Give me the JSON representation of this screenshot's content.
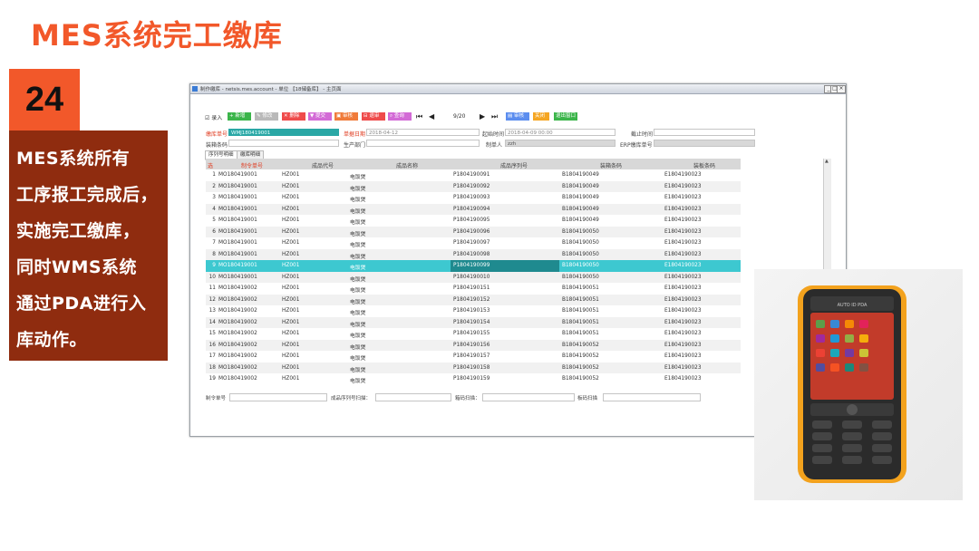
{
  "slide": {
    "title": "MES系统完工缴库",
    "number": "24",
    "description_lines": [
      "MES系统所有",
      "工序报工完成后，",
      "实施完工缴库，",
      "同时WMS系统",
      "通过PDA进行入",
      "库动作。"
    ]
  },
  "window": {
    "title": "制作缴库 - netsis.mes.account - 单位 【18储备库】 - 主页面",
    "controls": [
      "_",
      "□",
      "×"
    ]
  },
  "toolbar": {
    "checkbox_label": "录入",
    "buttons": [
      {
        "label": "新增",
        "color": "#3bb54a"
      },
      {
        "label": "修改",
        "color": "#b9b9b9"
      },
      {
        "label": "删除",
        "color": "#ef4b4b"
      },
      {
        "label": "提交",
        "color": "#d36ad6"
      },
      {
        "label": "审核",
        "color": "#f07b3a"
      },
      {
        "label": "退审",
        "color": "#ef4b4b"
      },
      {
        "label": "查询",
        "color": "#d36ad6"
      }
    ],
    "page": "9/20",
    "extra_buttons": [
      {
        "label": "审核",
        "color": "#5b8def"
      },
      {
        "label": "关闭",
        "color": "#f5a623"
      },
      {
        "label": "退出窗口",
        "color": "#3bb54a"
      }
    ]
  },
  "form": {
    "doc_no_label": "缴库单号",
    "doc_no_value": "WMJ180419001",
    "doc_date_label": "单据日期",
    "doc_date_value": "2018-04-12",
    "start_time_label": "起始时间",
    "start_time_value": "2018-04-09 00:00",
    "end_time_label": "截止时间",
    "end_time_value": "",
    "box_label": "装箱条码",
    "box_value": "",
    "dept_label": "生产部门",
    "dept_value": "",
    "creator_label": "制单人",
    "creator_value": "zzh",
    "erp_label": "ERP缴库单号",
    "erp_value": ""
  },
  "tabs": [
    "序列号明细",
    "缴库明细"
  ],
  "grid": {
    "headers": [
      "选",
      "制令单号",
      "成品代号",
      "成品名称",
      "成品序列号",
      "装箱条码",
      "装板条码"
    ],
    "rows": [
      {
        "no": "1",
        "mo": "MO180419001",
        "code": "HZ001",
        "name": "电饭煲",
        "serial": "P1804190091",
        "box": "B1804190049",
        "board": "E1804190023"
      },
      {
        "no": "2",
        "mo": "MO180419001",
        "code": "HZ001",
        "name": "电饭煲",
        "serial": "P1804190092",
        "box": "B1804190049",
        "board": "E1804190023"
      },
      {
        "no": "3",
        "mo": "MO180419001",
        "code": "HZ001",
        "name": "电饭煲",
        "serial": "P1804190093",
        "box": "B1804190049",
        "board": "E1804190023"
      },
      {
        "no": "4",
        "mo": "MO180419001",
        "code": "HZ001",
        "name": "电饭煲",
        "serial": "P1804190094",
        "box": "B1804190049",
        "board": "E1804190023"
      },
      {
        "no": "5",
        "mo": "MO180419001",
        "code": "HZ001",
        "name": "电饭煲",
        "serial": "P1804190095",
        "box": "B1804190049",
        "board": "E1804190023"
      },
      {
        "no": "6",
        "mo": "MO180419001",
        "code": "HZ001",
        "name": "电饭煲",
        "serial": "P1804190096",
        "box": "B1804190050",
        "board": "E1804190023"
      },
      {
        "no": "7",
        "mo": "MO180419001",
        "code": "HZ001",
        "name": "电饭煲",
        "serial": "P1804190097",
        "box": "B1804190050",
        "board": "E1804190023"
      },
      {
        "no": "8",
        "mo": "MO180419001",
        "code": "HZ001",
        "name": "电饭煲",
        "serial": "P1804190098",
        "box": "B1804190050",
        "board": "E1804190023"
      },
      {
        "no": "9",
        "mo": "MO180419001",
        "code": "HZ001",
        "name": "电饭煲",
        "serial": "P1804190099",
        "box": "B1804190050",
        "board": "E1804190023"
      },
      {
        "no": "10",
        "mo": "MO180419001",
        "code": "HZ001",
        "name": "电饭煲",
        "serial": "P1804190010",
        "box": "B1804190050",
        "board": "E1804190023"
      },
      {
        "no": "11",
        "mo": "MO180419002",
        "code": "HZ001",
        "name": "电饭煲",
        "serial": "P1804190151",
        "box": "B1804190051",
        "board": "E1804190023"
      },
      {
        "no": "12",
        "mo": "MO180419002",
        "code": "HZ001",
        "name": "电饭煲",
        "serial": "P1804190152",
        "box": "B1804190051",
        "board": "E1804190023"
      },
      {
        "no": "13",
        "mo": "MO180419002",
        "code": "HZ001",
        "name": "电饭煲",
        "serial": "P1804190153",
        "box": "B1804190051",
        "board": "E1804190023"
      },
      {
        "no": "14",
        "mo": "MO180419002",
        "code": "HZ001",
        "name": "电饭煲",
        "serial": "P1804190154",
        "box": "B1804190051",
        "board": "E1804190023"
      },
      {
        "no": "15",
        "mo": "MO180419002",
        "code": "HZ001",
        "name": "电饭煲",
        "serial": "P1804190155",
        "box": "B1804190051",
        "board": "E1804190023"
      },
      {
        "no": "16",
        "mo": "MO180419002",
        "code": "HZ001",
        "name": "电饭煲",
        "serial": "P1804190156",
        "box": "B1804190052",
        "board": "E1804190023"
      },
      {
        "no": "17",
        "mo": "MO180419002",
        "code": "HZ001",
        "name": "电饭煲",
        "serial": "P1804190157",
        "box": "B1804190052",
        "board": "E1804190023"
      },
      {
        "no": "18",
        "mo": "MO180419002",
        "code": "HZ001",
        "name": "电饭煲",
        "serial": "P1804190158",
        "box": "B1804190052",
        "board": "E1804190023"
      },
      {
        "no": "19",
        "mo": "MO180419002",
        "code": "HZ001",
        "name": "电饭煲",
        "serial": "P1804190159",
        "box": "B1804190052",
        "board": "E1804190023"
      }
    ],
    "selected_row": "9"
  },
  "bottom_bar": {
    "mo_label": "制令单号",
    "serial_scan_label": "成品序列号扫描：",
    "box_scan_label": "箱码扫描：",
    "board_scan_label": "板码扫描"
  },
  "device_photo": {
    "brand": "AUTO ID PDA"
  },
  "colors": {
    "accent": "#f2582a",
    "desc_bg": "#8f2c0f",
    "selected_row": "#3dc8d0",
    "teal_input": "#2aa7a5"
  }
}
